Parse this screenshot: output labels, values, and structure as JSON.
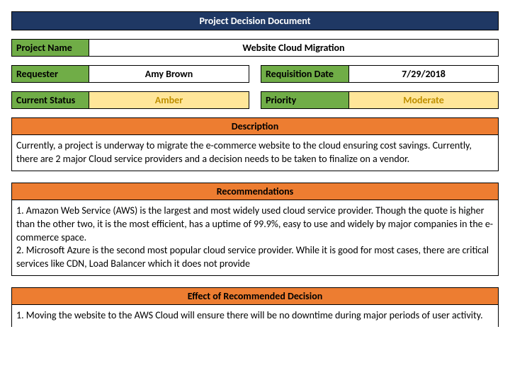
{
  "title": "Project Decision Document",
  "fields": {
    "project_name_label": "Project Name",
    "project_name_value": "Website Cloud Migration",
    "requester_label": "Requester",
    "requester_value": "Amy Brown",
    "requisition_date_label": "Requisition Date",
    "requisition_date_value": "7/29/2018",
    "current_status_label": "Current Status",
    "current_status_value": "Amber",
    "priority_label": "Priority",
    "priority_value": "Moderate"
  },
  "sections": {
    "description": {
      "header": "Description",
      "body": "Currently, a project is underway to migrate the e-commerce website to the cloud ensuring cost savings. Currently, there are 2 major Cloud service providers and a decision needs to be taken to finalize on a vendor."
    },
    "recommendations": {
      "header": "Recommendations",
      "body": "1. Amazon Web Service (AWS) is the largest and most widely used cloud service provider. Though the quote is higher than the other two, it is the most efficient, has a uptime of 99.9%, easy to use and widely by major companies in the e-commerce space.\n2. Microsoft Azure is the second most popular cloud service provider. While it is good for most cases, there are critical services like CDN, Load Balancer which it does not provide"
    },
    "effect": {
      "header": "Effect of Recommended Decision",
      "body": "1. Moving the website to the AWS Cloud will ensure there will be no downtime during major periods of user activity."
    }
  }
}
